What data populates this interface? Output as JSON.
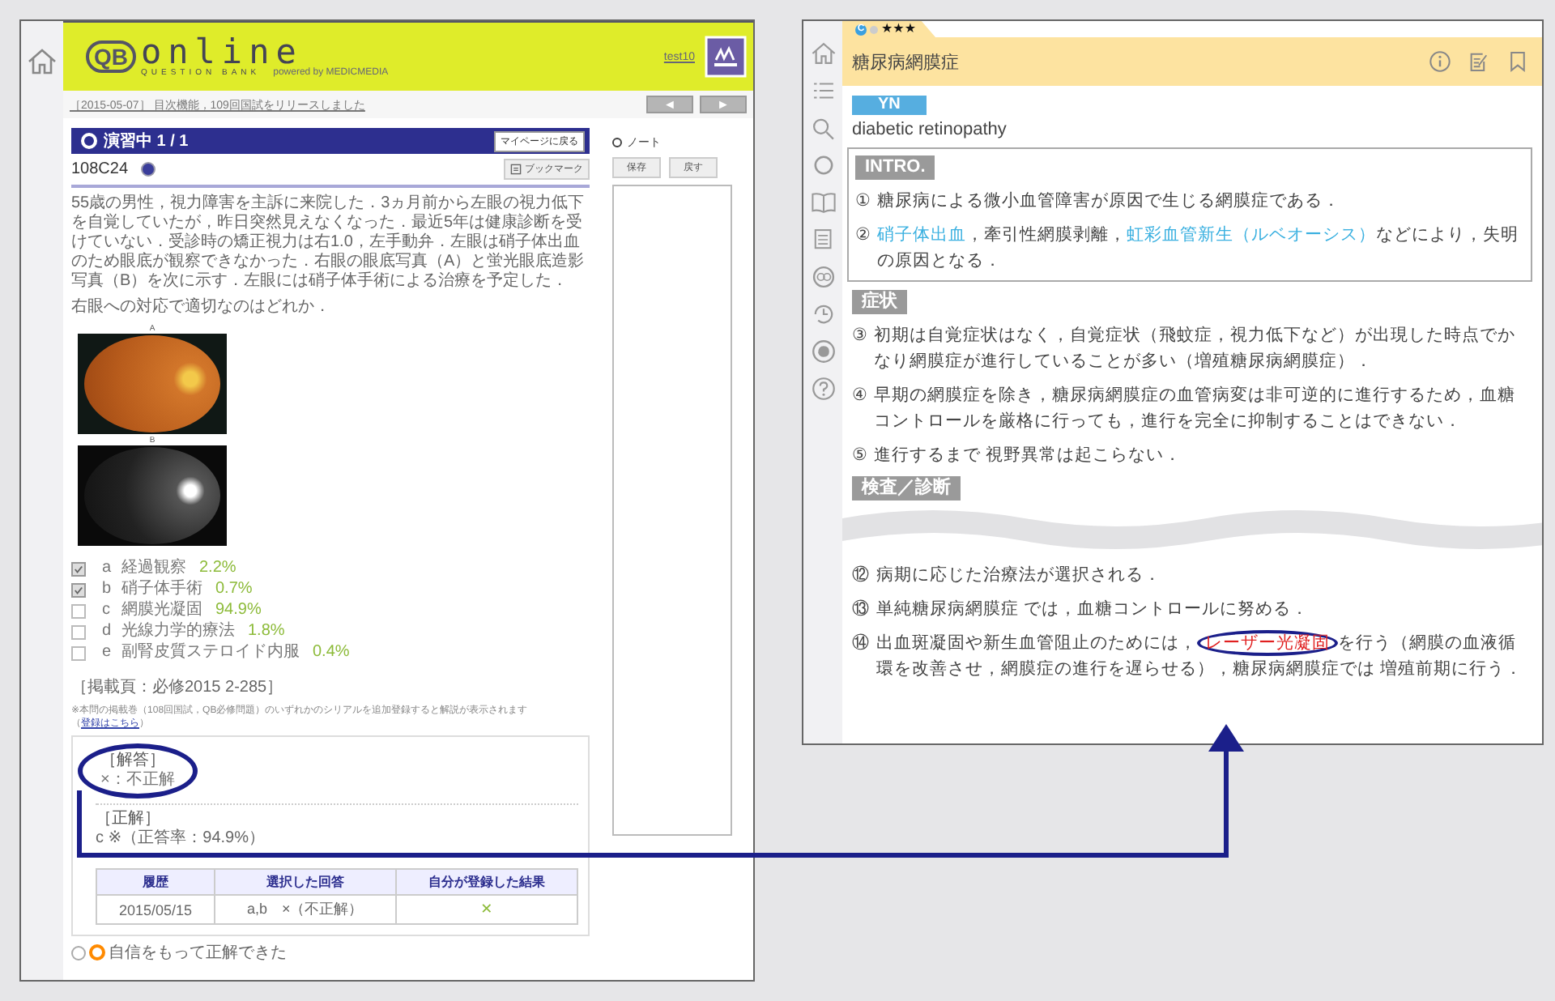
{
  "left": {
    "logo": {
      "mark": "QB",
      "title": "online",
      "subtitle": "QUESTION BANK",
      "powered": "powered by MEDICMEDIA"
    },
    "user": "test10",
    "news": "［2015-05-07］ 目次機能，109回国試をリリースしました",
    "nav_buttons": [
      "◄",
      "►"
    ],
    "practice": {
      "status": "演習中 1 / 1",
      "mypage_button": "マイページに戻る"
    },
    "question_id": "108C24",
    "bookmark_button": "ブックマーク",
    "question_text": "55歳の男性，視力障害を主訴に来院した．3ヵ月前から左眼の視力低下を自覚していたが，昨日突然見えなくなった．最近5年は健康診断を受けていない．受診時の矯正視力は右1.0，左手動弁．左眼は硝子体出血のため眼底が観察できなかった．右眼の眼底写真（A）と蛍光眼底造影写真（B）を次に示す．左眼には硝子体手術による治療を予定した．",
    "question_prompt": "右眼への対応で適切なのはどれか．",
    "images": [
      {
        "label": "A",
        "kind": "fundus"
      },
      {
        "label": "B",
        "kind": "angiogram"
      }
    ],
    "options": [
      {
        "letter": "a",
        "text": "経過観察",
        "rate": "2.2%",
        "checked": true
      },
      {
        "letter": "b",
        "text": "硝子体手術",
        "rate": "0.7%",
        "checked": true
      },
      {
        "letter": "c",
        "text": "網膜光凝固",
        "rate": "94.9%",
        "checked": false
      },
      {
        "letter": "d",
        "text": "光線力学的療法",
        "rate": "1.8%",
        "checked": false
      },
      {
        "letter": "e",
        "text": "副腎皮質ステロイド内服",
        "rate": "0.4%",
        "checked": false
      }
    ],
    "source": "［掲載頁：必修2015 2-285］",
    "notice": "※本問の掲載巻（108回国試，QB必修問題）のいずれかのシリアルを追加登録すると解説が表示されます（",
    "notice_link": "登録はこちら",
    "notice_end": "）",
    "answer": {
      "heading": "［解答］",
      "value": "×：不正解",
      "correct_heading": "［正解］",
      "correct_value": "c ※（正答率：94.9%）"
    },
    "history": {
      "columns": [
        "履歴",
        "選択した回答",
        "自分が登録した結果"
      ],
      "rows": [
        {
          "date": "2015/05/15",
          "answer": "a,b　×（不正解）",
          "result": "✕"
        }
      ]
    },
    "confidence": {
      "label": "自信をもって正解できた",
      "selected": false
    },
    "note": {
      "title": "ノート",
      "buttons": [
        "保存",
        "戻す"
      ]
    }
  },
  "right": {
    "tab": {
      "badge": "C",
      "stars": 3
    },
    "title": "糖尿病網膜症",
    "tag": "YN",
    "english": "diabetic  retinopathy",
    "sections": [
      {
        "heading": "INTRO.",
        "boxed": true,
        "gap_before_items": false,
        "items": [
          {
            "num": "①",
            "segments": [
              {
                "kind": "plain",
                "text": "糖尿病による微小血管障害が原因で生じる網膜症である．"
              }
            ]
          },
          {
            "num": "②",
            "segments": [
              {
                "kind": "link",
                "text": "硝子体出血"
              },
              {
                "kind": "plain",
                "text": "，牽引性網膜剥離，"
              },
              {
                "kind": "link",
                "text": "虹彩血管新生（ルベオーシス）"
              },
              {
                "kind": "plain",
                "text": "などにより，失明の原因となる．"
              }
            ]
          }
        ]
      },
      {
        "heading": "症状",
        "boxed": false,
        "gap_before_items": false,
        "items": [
          {
            "num": "③",
            "segments": [
              {
                "kind": "plain",
                "text": "初期は自覚症状はなく，自覚症状（飛蚊症，視力低下など）が出現した時点でかなり網膜症が進行していることが多い（増殖糖尿病網膜症）．"
              }
            ]
          },
          {
            "num": "④",
            "segments": [
              {
                "kind": "plain",
                "text": "早期の網膜症を除き，糖尿病網膜症の血管病変は非可逆的に進行するため，血糖コントロールを厳格に行っても，進行を完全に抑制することはできない．"
              }
            ]
          },
          {
            "num": "⑤",
            "segments": [
              {
                "kind": "plain",
                "text": "進行するまで 視野異常は起こらない．"
              }
            ]
          }
        ]
      },
      {
        "heading": "検査／診断",
        "boxed": false,
        "gap_before_items": true,
        "items": [
          {
            "num": "⑫",
            "segments": [
              {
                "kind": "plain",
                "text": "病期に応じた治療法が選択される．"
              }
            ]
          },
          {
            "num": "⑬",
            "segments": [
              {
                "kind": "plain",
                "text": "単純糖尿病網膜症 では，血糖コントロールに努める．"
              }
            ]
          },
          {
            "num": "⑭",
            "segments": [
              {
                "kind": "plain",
                "text": "出血斑凝固や新生血管阻止のためには，"
              },
              {
                "kind": "circled",
                "text": "レーザー光凝固"
              },
              {
                "kind": "plain",
                "text": "を行う（網膜の血液循環を改善させ，網膜症の進行を遅らせる），糖尿病網膜症では 増殖前期に行う．"
              }
            ]
          }
        ]
      }
    ]
  }
}
